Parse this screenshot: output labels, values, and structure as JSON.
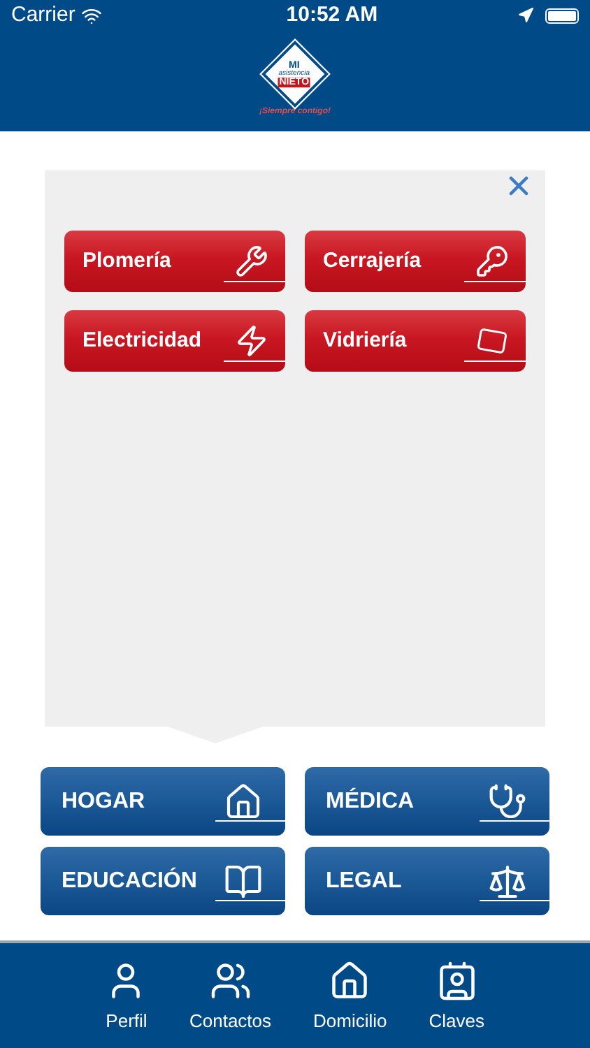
{
  "status_bar": {
    "carrier": "Carrier",
    "time": "10:52 AM"
  },
  "logo": {
    "line_1": "MI",
    "line_2": "asistencia",
    "line_3": "NIETO",
    "slogan": "¡Siempre contigo!"
  },
  "services": [
    {
      "label": "Plomería",
      "kind": "plumbing"
    },
    {
      "label": "Cerrajería",
      "kind": "locksmith"
    },
    {
      "label": "Electricidad",
      "kind": "electric"
    },
    {
      "label": "Vidriería",
      "kind": "glass"
    }
  ],
  "categories": [
    {
      "label": "HOGAR",
      "kind": "home"
    },
    {
      "label": "MÉDICA",
      "kind": "medical"
    },
    {
      "label": "EDUCACIÓN",
      "kind": "education"
    },
    {
      "label": "LEGAL",
      "kind": "legal"
    }
  ],
  "tab_bar": [
    {
      "label": "Perfil",
      "kind": "profile"
    },
    {
      "label": "Contactos",
      "kind": "contacts"
    },
    {
      "label": "Domicilio",
      "kind": "home"
    },
    {
      "label": "Claves",
      "kind": "card"
    }
  ]
}
